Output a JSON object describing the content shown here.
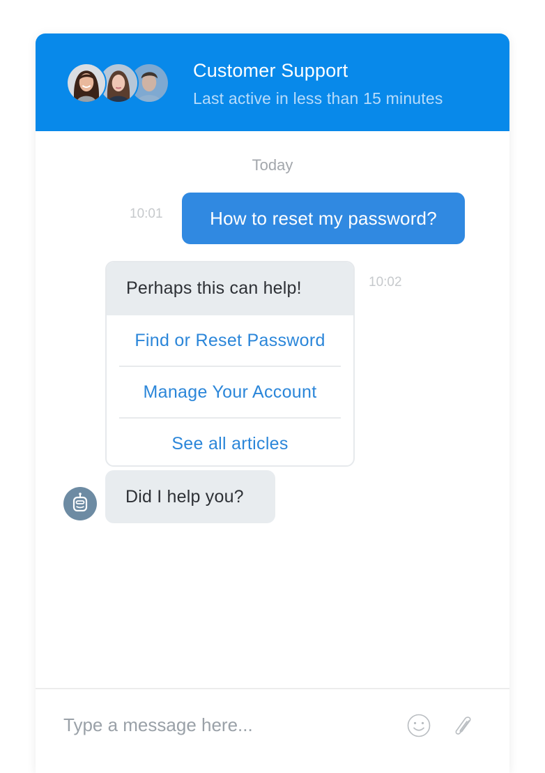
{
  "header": {
    "title": "Customer Support",
    "subtitle": "Last active in less than 15 minutes",
    "avatars": [
      {
        "name": "agent-avatar-1",
        "description": "woman with dark hair"
      },
      {
        "name": "agent-avatar-2",
        "description": "woman with brown hair"
      },
      {
        "name": "agent-avatar-3",
        "description": "man with short hair"
      }
    ]
  },
  "conversation": {
    "day_label": "Today",
    "messages": [
      {
        "sender": "user",
        "time": "10:01",
        "text": "How to reset my password?"
      },
      {
        "sender": "bot",
        "time": "10:02",
        "text": "Perhaps this can help!",
        "links": [
          {
            "label": "Find or Reset Password"
          },
          {
            "label": "Manage Your Account"
          },
          {
            "label": "See all articles"
          }
        ]
      },
      {
        "sender": "bot",
        "text": "Did I help you?",
        "avatar_icon": "robot-icon"
      }
    ]
  },
  "composer": {
    "placeholder": "Type a message here...",
    "value": "",
    "icons": [
      "emoji-icon",
      "paperclip-icon"
    ]
  },
  "colors": {
    "header_bg": "#0889ea",
    "user_bubble": "#3089e1",
    "bot_bubble": "#e8ecef",
    "link": "#2b86d9",
    "bot_avatar": "#6d8ba3"
  }
}
